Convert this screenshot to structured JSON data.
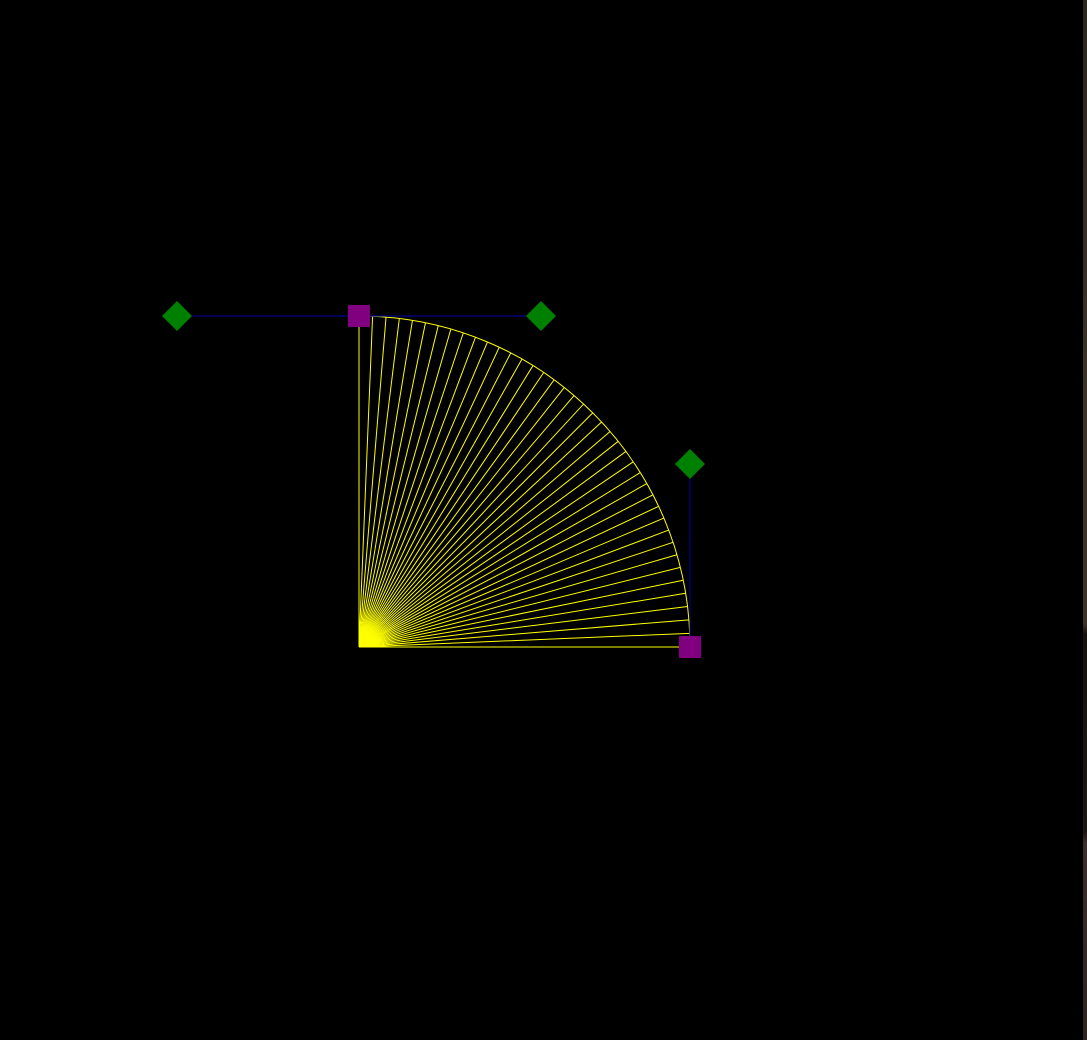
{
  "scene": {
    "background": "#000000",
    "colors": {
      "ray_fill": "#ffff00",
      "control_line": "#00008b",
      "anchor_handle": "#800080",
      "control_handle": "#008000"
    },
    "ray_count": 40,
    "handles": {
      "anchors": [
        "anchor-start",
        "anchor-end"
      ],
      "controls": [
        "control-start-left",
        "control-start-right",
        "control-end-top"
      ]
    }
  }
}
